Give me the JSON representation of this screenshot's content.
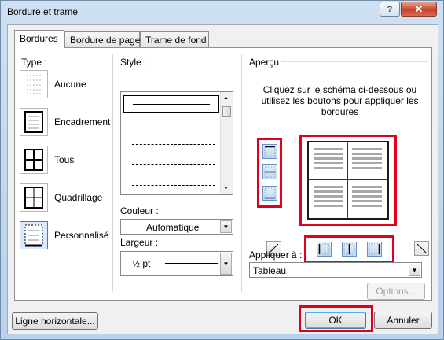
{
  "window": {
    "title": "Bordure et trame",
    "help_label": "?",
    "close_label": "✕"
  },
  "tabs": [
    {
      "label": "Bordures"
    },
    {
      "label": "Bordure de page"
    },
    {
      "label": "Trame de fond"
    }
  ],
  "type": {
    "heading": "Type :",
    "items": [
      {
        "label": "Aucune"
      },
      {
        "label": "Encadrement"
      },
      {
        "label": "Tous"
      },
      {
        "label": "Quadrillage"
      },
      {
        "label": "Personnalisé"
      }
    ],
    "selected": "Personnalisé"
  },
  "style": {
    "heading": "Style :"
  },
  "color": {
    "heading": "Couleur :",
    "value": "Automatique"
  },
  "width": {
    "heading": "Largeur :",
    "value": "½ pt"
  },
  "preview": {
    "heading": "Aperçu",
    "hint": "Cliquez sur le schéma ci-dessous ou utilisez les boutons pour appliquer les bordures"
  },
  "apply": {
    "heading": "Appliquer à :",
    "value": "Tableau"
  },
  "buttons": {
    "options": "Options...",
    "horizontal_line": "Ligne horizontale...",
    "ok": "OK",
    "cancel": "Annuler"
  },
  "colors": {
    "highlight": "#e0001a",
    "border_button": "#6792c0"
  }
}
